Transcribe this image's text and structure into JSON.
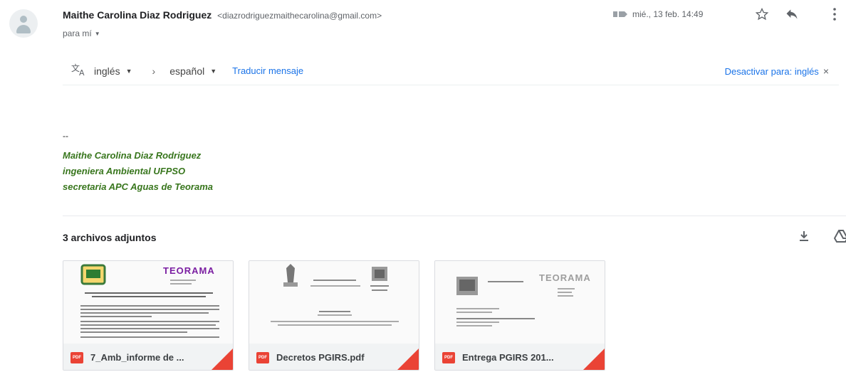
{
  "sender": {
    "name": "Maithe Carolina Diaz Rodriguez",
    "email": "<diazrodriguezmaithecarolina@gmail.com>",
    "to": "para mí"
  },
  "meta": {
    "date": "mié., 13 feb. 14:49"
  },
  "translate": {
    "source_lang": "inglés",
    "target_lang": "español",
    "translate_link": "Traducir mensaje",
    "deactivate": "Desactivar para: inglés"
  },
  "signature": {
    "dash": "--",
    "line1": "Maithe Carolina Diaz Rodriguez",
    "line2": "ingeniera Ambiental UFPSO",
    "line3": "secretaria APC Aguas de Teorama"
  },
  "attachments": {
    "title": "3 archivos adjuntos",
    "files": [
      {
        "name": "7_Amb_informe de ...",
        "badge": "PDF",
        "logo": "TEORAMA"
      },
      {
        "name": "Decretos PGIRS.pdf",
        "badge": "PDF"
      },
      {
        "name": "Entrega PGIRS 201...",
        "badge": "PDF",
        "logo": "TEORAMA"
      }
    ]
  },
  "colors": {
    "signature_green": "#38761d",
    "link_blue": "#1a73e8",
    "pdf_red": "#ea4335"
  }
}
